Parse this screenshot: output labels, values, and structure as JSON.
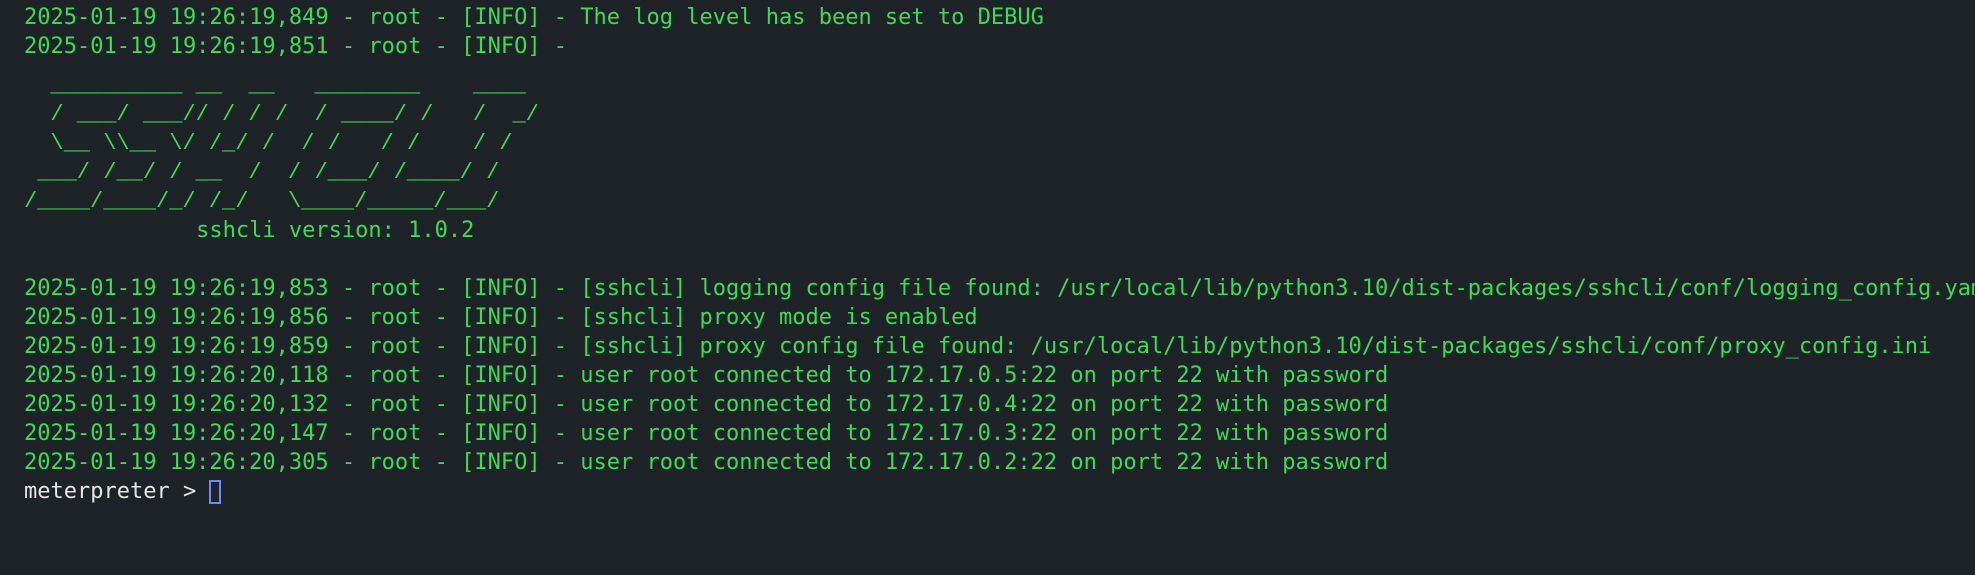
{
  "terminal": {
    "log_lines_top": [
      "2025-01-19 19:26:19,849 - root - [INFO] - The log level has been set to DEBUG",
      "2025-01-19 19:26:19,851 - root - [INFO] -"
    ],
    "ascii_banner": "  __________ __  __   ________    ____\n  / ___/ ___// / / /  / ____/ /   /  _/\n  \\__ \\\\__ \\/ /_/ /  / /   / /    / /\n ___/ /__/ / __  /  / /___/ /____/ /\n/____/____/_/ /_/   \\____/_____/___/",
    "version_line": "             sshcli version: 1.0.2",
    "log_lines_bottom": [
      "2025-01-19 19:26:19,853 - root - [INFO] - [sshcli] logging config file found: /usr/local/lib/python3.10/dist-packages/sshcli/conf/logging_config.yaml",
      "2025-01-19 19:26:19,856 - root - [INFO] - [sshcli] proxy mode is enabled",
      "2025-01-19 19:26:19,859 - root - [INFO] - [sshcli] proxy config file found: /usr/local/lib/python3.10/dist-packages/sshcli/conf/proxy_config.ini",
      "2025-01-19 19:26:20,118 - root - [INFO] - user root connected to 172.17.0.5:22 on port 22 with password",
      "2025-01-19 19:26:20,132 - root - [INFO] - user root connected to 172.17.0.4:22 on port 22 with password",
      "2025-01-19 19:26:20,147 - root - [INFO] - user root connected to 172.17.0.3:22 on port 22 with password",
      "2025-01-19 19:26:20,305 - root - [INFO] - user root connected to 172.17.0.2:22 on port 22 with password"
    ],
    "prompt": "meterpreter >"
  },
  "colors": {
    "background": "#1e2327",
    "log_text": "#3ddc56",
    "prompt_text": "#e6e6e6",
    "cursor": "#6b8cff"
  }
}
